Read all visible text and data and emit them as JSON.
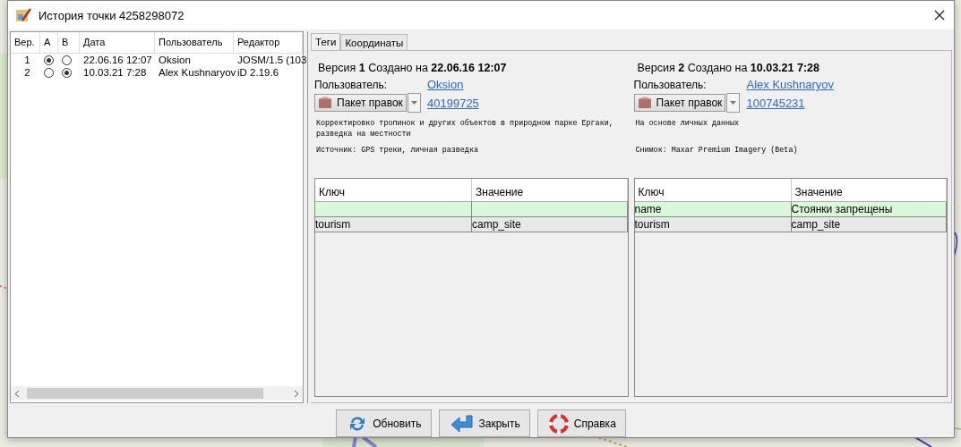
{
  "window": {
    "title": "История точки 4258298072"
  },
  "history": {
    "columns": [
      "Вер.",
      "A",
      "B",
      "Дата",
      "Пользователь",
      "Редактор"
    ],
    "rows": [
      {
        "version": "1",
        "a": {
          "selected": true
        },
        "b": {
          "selected": false
        },
        "date": "22.06.16 12:07",
        "user": "Oksion",
        "editor": "JOSM/1.5 (103"
      },
      {
        "version": "2",
        "a": {
          "selected": false
        },
        "b": {
          "selected": true
        },
        "date": "10.03.21 7:28",
        "user": "Alex Kushnaryov",
        "editor": "iD 2.19.6"
      }
    ]
  },
  "tabs": [
    {
      "label": "Теги",
      "selected": true
    },
    {
      "label": "Координаты",
      "selected": false
    }
  ],
  "versions": [
    {
      "heading": "Версия **1** Создано на **22.06.16 12:07**",
      "user_label": "Пользователь:",
      "user": "Oksion",
      "changeset_button": "Пакет правок",
      "changeset": "40199725",
      "comment": "Корректировко тропинок и других объектов в природном парке Ергаки, разведка на местности",
      "source": "Источник: GPS треки, личная разведка",
      "tags": {
        "columns": [
          "Ключ",
          "Значение"
        ],
        "rows": [
          {
            "changed": true
          },
          {
            "key": "tourism",
            "value": "camp_site",
            "changed": false
          }
        ]
      }
    },
    {
      "heading": "Версия **2** Создано на **10.03.21 7:28**",
      "user_label": "Пользователь:",
      "user": "Alex Kushnaryov",
      "changeset_button": "Пакет правок",
      "changeset": "100745231",
      "comment": "На основе личных данных",
      "source": "Снимок: Maxar Premium Imagery (Beta)",
      "tags": {
        "columns": [
          "Ключ",
          "Значение"
        ],
        "rows": [
          {
            "key": "name",
            "value": "Стоянки запрещены",
            "changed": true
          },
          {
            "key": "tourism",
            "value": "camp_site",
            "changed": false
          }
        ]
      }
    }
  ],
  "buttons": [
    {
      "label": "Обновить",
      "kind": "refresh"
    },
    {
      "label": "Закрыть",
      "kind": "close"
    },
    {
      "label": "Справка",
      "kind": "help"
    }
  ]
}
